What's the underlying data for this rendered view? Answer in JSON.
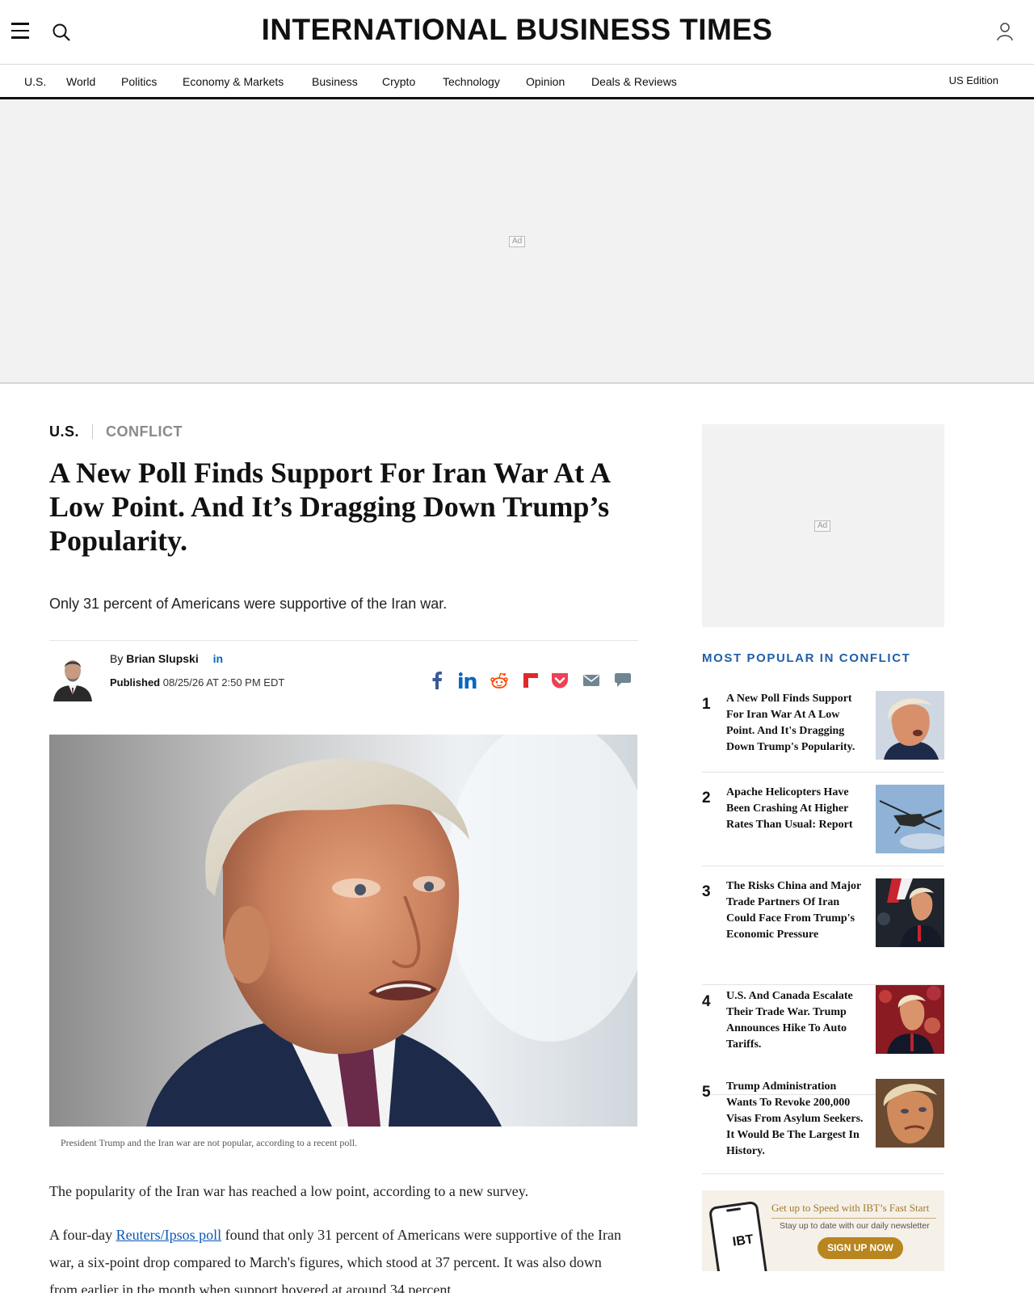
{
  "header": {
    "logo": "INTERNATIONAL BUSINESS TIMES",
    "nav": [
      "U.S.",
      "World",
      "Politics",
      "Economy & Markets",
      "Business",
      "Crypto",
      "Technology",
      "Opinion",
      "Deals & Reviews"
    ],
    "edition": "US Edition"
  },
  "ads": {
    "label": "Ad"
  },
  "article": {
    "category": "U.S.",
    "subcategory": "CONFLICT",
    "headline": "A New Poll Finds Support For Iran War At A Low Point. And It’s Dragging Down Trump’s Popularity.",
    "dek": "Only 31 percent of Americans were supportive of the Iran war.",
    "author_prefix": "By",
    "author": "Brian Slupski",
    "author_linkedin": "in",
    "published_label": "Published",
    "published": "08/25/26 AT 2:50 PM EDT",
    "share_icons": [
      "facebook-icon",
      "linkedin-icon",
      "reddit-icon",
      "flipboard-icon",
      "pocket-icon",
      "email-icon",
      "comment-icon"
    ],
    "caption": "President Trump and the Iran war are not popular, according to a recent poll.",
    "para1": "The popularity of the Iran war has reached a low point, according to a new survey.",
    "para2_before": "A four-day ",
    "para2_link": "Reuters/Ipsos poll",
    "para2_after": " found that only 31 percent of Americans were supportive of the Iran war, a six-point drop compared to March's figures, which stood at 37 percent. It was also down from earlier in the month when support hovered at around 34 percent."
  },
  "sidebar": {
    "popular_title": "MOST POPULAR IN CONFLICT",
    "items": [
      {
        "num": "1",
        "title": "A New Poll Finds Support For Iran War At A Low Point. And It's Dragging Down Trump's Popularity."
      },
      {
        "num": "2",
        "title": "Apache Helicopters Have Been Crashing At Higher Rates Than Usual: Report"
      },
      {
        "num": "3",
        "title": "The Risks China and Major Trade Partners Of Iran Could Face From Trump's Economic Pressure"
      },
      {
        "num": "4",
        "title": "U.S. And Canada Escalate Their Trade War. Trump Announces Hike To Auto Tariffs."
      },
      {
        "num": "5",
        "title": "Trump Administration Wants To Revoke 200,000 Visas From Asylum Seekers. It Would Be The Largest In History."
      }
    ],
    "promo": {
      "title": "Get up to Speed with IBT’s Fast Start",
      "subtitle": "Stay up to date with our daily newsletter",
      "button": "SIGN UP NOW",
      "phone_logo": "IBT"
    }
  },
  "colors": {
    "accent": "#1f5fa8",
    "link": "#0a58b8",
    "promo_button": "#b9851f"
  }
}
